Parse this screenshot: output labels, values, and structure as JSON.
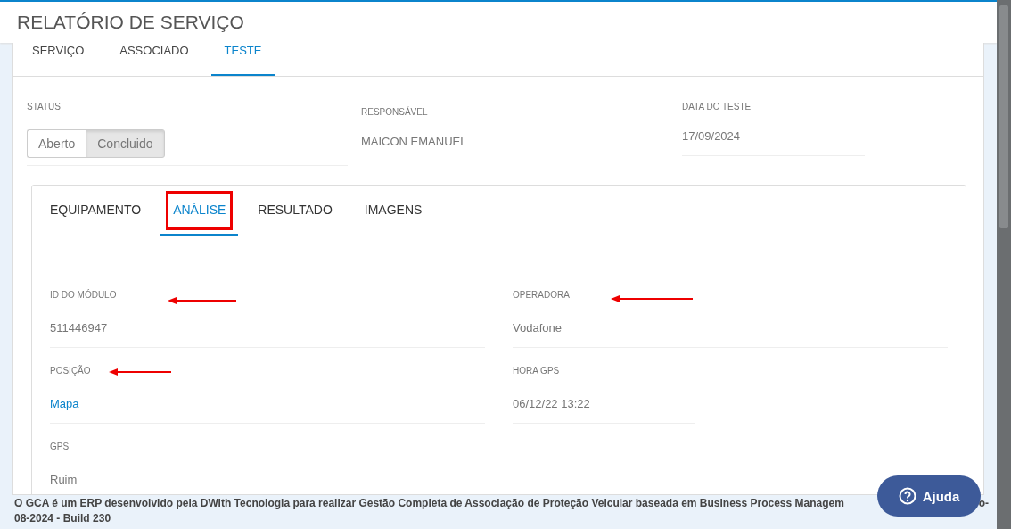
{
  "header": {
    "title": "RELATÓRIO DE SERVIÇO"
  },
  "tabs": [
    {
      "label": "SERVIÇO",
      "selected": false
    },
    {
      "label": "ASSOCIADO",
      "selected": false
    },
    {
      "label": "TESTE",
      "selected": true
    }
  ],
  "status": {
    "label": "STATUS",
    "options": [
      {
        "label": "Aberto",
        "selected": false
      },
      {
        "label": "Concluido",
        "selected": true
      }
    ]
  },
  "responsavel": {
    "label": "RESPONSÁVEL",
    "value": "MAICON EMANUEL"
  },
  "data_teste": {
    "label": "DATA DO TESTE",
    "value": "17/09/2024"
  },
  "sub_tabs": [
    {
      "label": "EQUIPAMENTO",
      "selected": false,
      "highlighted": false
    },
    {
      "label": "ANÁLISE",
      "selected": true,
      "highlighted": true
    },
    {
      "label": "RESULTADO",
      "selected": false,
      "highlighted": false
    },
    {
      "label": "IMAGENS",
      "selected": false,
      "highlighted": false
    }
  ],
  "fields": [
    {
      "label": "ID DO MÓDULO",
      "value": "511446947",
      "kind": "text",
      "arrow": true
    },
    {
      "label": "OPERADORA",
      "value": "Vodafone",
      "kind": "text",
      "arrow": true
    },
    {
      "label": "POSIÇÃO",
      "value": "Mapa",
      "kind": "link",
      "arrow": true
    },
    {
      "label": "HORA GPS",
      "value": "06/12/22 13:22",
      "kind": "text",
      "arrow": false
    },
    {
      "label": "GPS",
      "value": "Ruim",
      "kind": "text",
      "arrow": false
    }
  ],
  "footer": {
    "line1": "O GCA é um ERP desenvolvido pela DWith Tecnologia para realizar Gestão Completa de Associação de Proteção Veicular baseada em Business Process Managem",
    "line1_end": "o-",
    "line2": "08-2024 - Build 230"
  },
  "help_button": {
    "label": "Ajuda"
  }
}
